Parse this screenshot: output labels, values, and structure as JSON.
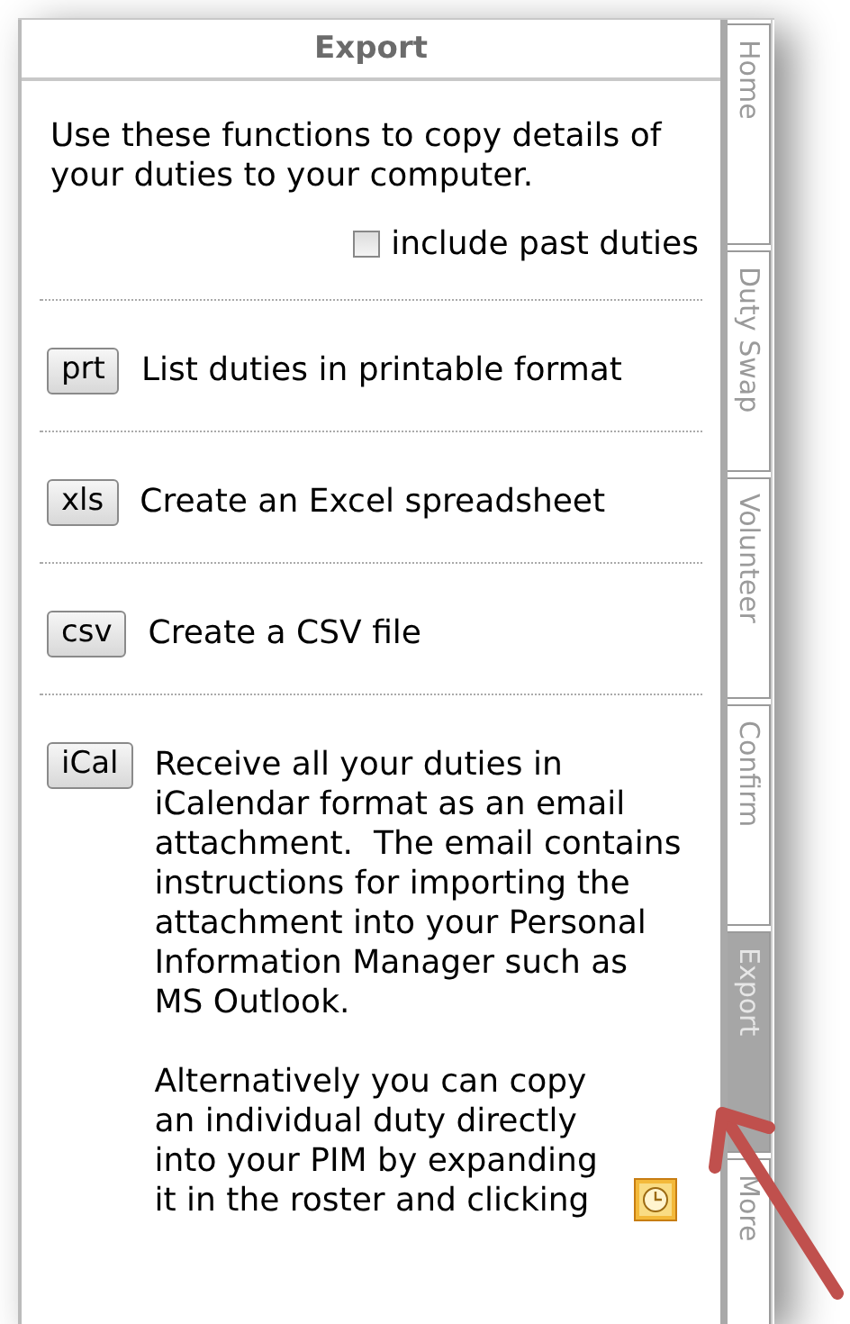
{
  "panel": {
    "title": "Export",
    "intro": "Use these functions to copy details of your duties to your computer.",
    "include_past": {
      "label": "include past duties",
      "checked": false
    }
  },
  "actions": [
    {
      "button": "prt",
      "paragraphs": [
        "List duties in printable format"
      ],
      "trailing_icon": false
    },
    {
      "button": "xls",
      "paragraphs": [
        "Create an Excel spreadsheet"
      ],
      "trailing_icon": false
    },
    {
      "button": "csv",
      "paragraphs": [
        "Create a CSV file"
      ],
      "trailing_icon": false
    },
    {
      "button": "iCal",
      "paragraphs": [
        "Receive all your duties in iCalendar format as an email attachment.  The email contains instructions for importing the attachment into your Personal Information Manager such as MS Outlook.",
        "Alternatively you can copy an individual duty directly into your PIM by expanding it in the roster and clicking"
      ],
      "trailing_icon": true
    }
  ],
  "tabs": [
    {
      "label": "Home",
      "selected": false
    },
    {
      "label": "Duty Swap",
      "selected": false
    },
    {
      "label": "Volunteer",
      "selected": false
    },
    {
      "label": "Confirm",
      "selected": false
    },
    {
      "label": "Export",
      "selected": true
    },
    {
      "label": "More",
      "selected": false
    }
  ]
}
